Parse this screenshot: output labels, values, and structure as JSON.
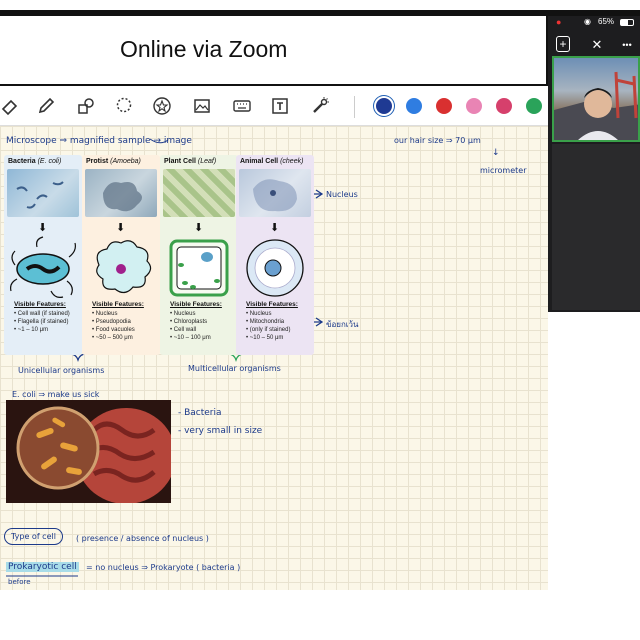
{
  "window": {
    "title": "Online via Zoom"
  },
  "zoom": {
    "battery": "65%",
    "wifi_glyph": "◉",
    "record_glyph": "●",
    "add_glyph": "+",
    "close_glyph": "✕",
    "more_glyph": "•••"
  },
  "toolbar": {
    "colors": [
      "#1f3a93",
      "#2f7de1",
      "#d93030",
      "#e984b4",
      "#d6406c",
      "#2aa35a"
    ]
  },
  "notes": {
    "microscope": "Microscope ⇒ magnified sample → image",
    "hair_size": "our hair size ⇒ 70 μm",
    "micrometer": "micrometer",
    "nucleus_label": "Nucleus",
    "thai_label": "ข้อยกเว้น",
    "unicellular": "Unicellular organisms",
    "multicellular": "Multicellular organisms",
    "ecoli": "E. coli ⇒ make us sick",
    "bacteria": "- Bacteria",
    "small": "- very small in size",
    "type_of_cell": "Type of cell",
    "presence": "( presence / absence of nucleus )",
    "prokaryotic": "Prokaryotic cell",
    "prokaryotic_def": "= no nucleus ⇒ Prokaryote ( bacteria )",
    "before": "before"
  },
  "cards": [
    {
      "name": "Bacteria",
      "sub": "(E. coli)",
      "bg": "#e4eef7",
      "features": [
        "Cell wall (if stained)",
        "Flagella (if stained)",
        "~1 – 10 μm"
      ]
    },
    {
      "name": "Protist",
      "sub": "(Amoeba)",
      "bg": "#fdf0e0",
      "features": [
        "Nucleus",
        "Pseudopodia",
        "Food vacuoles",
        "~50 – 500 μm"
      ]
    },
    {
      "name": "Plant Cell",
      "sub": "(Leaf)",
      "bg": "#eef4e4",
      "features": [
        "Nucleus",
        "Chloroplasts",
        "Cell wall",
        "~10 – 100 μm"
      ]
    },
    {
      "name": "Animal Cell",
      "sub": "(cheek)",
      "bg": "#ece4f3",
      "features": [
        "Nucleus",
        "Mitochondria",
        "(only if stained)",
        "~10 – 50 μm"
      ]
    }
  ],
  "feature_heading": "Visible Features:"
}
